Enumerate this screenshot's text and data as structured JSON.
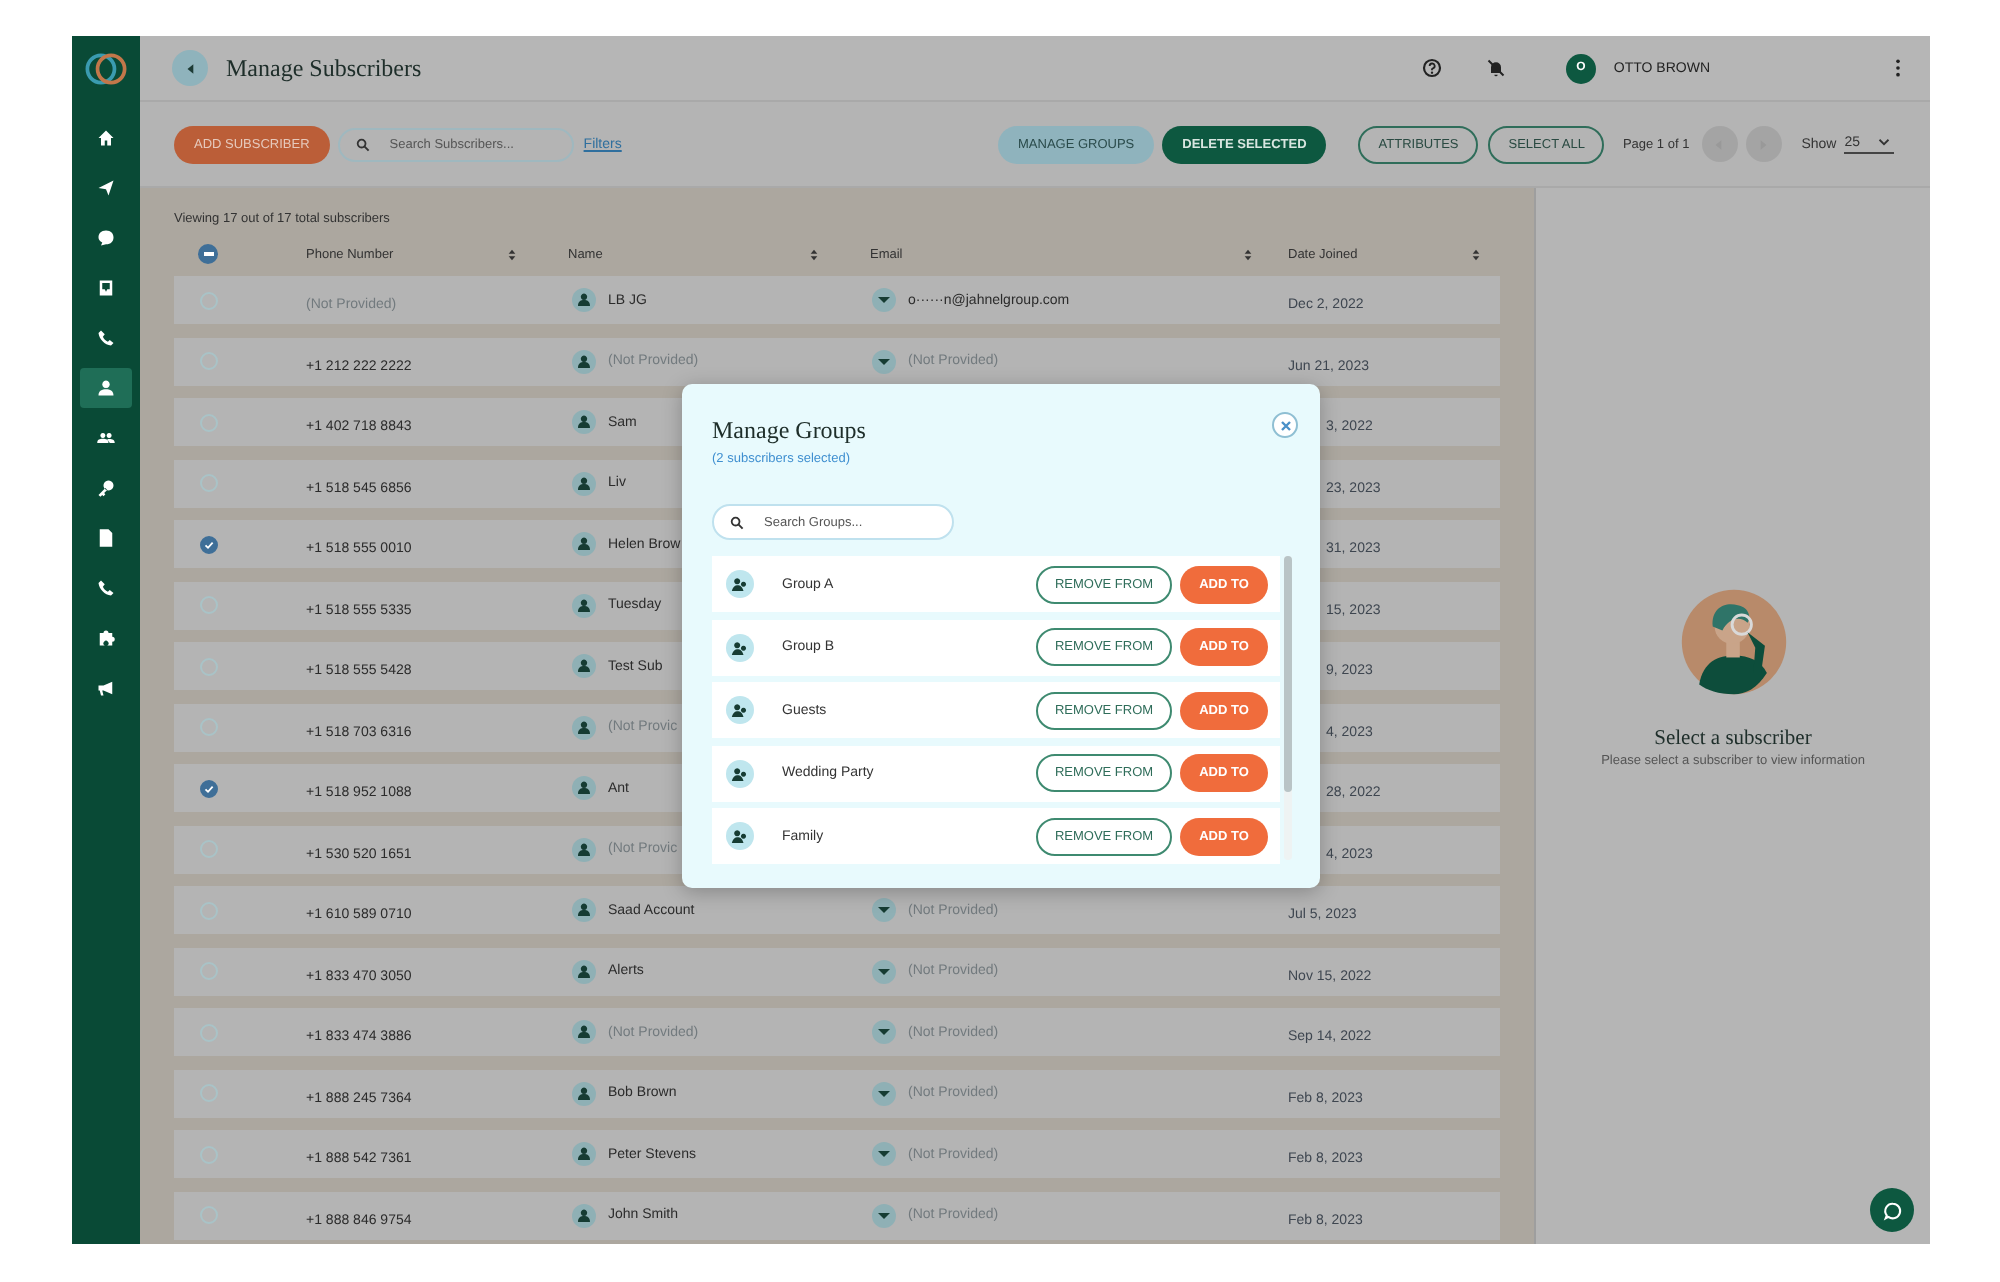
{
  "sidebar": {
    "items": [
      {
        "selected": false
      },
      {
        "selected": false
      },
      {
        "selected": false
      },
      {
        "selected": false
      },
      {
        "selected": false
      },
      {
        "selected": true
      },
      {
        "selected": false
      },
      {
        "selected": false
      },
      {
        "selected": false
      },
      {
        "selected": false
      },
      {
        "selected": false
      },
      {
        "selected": false
      }
    ]
  },
  "header": {
    "title": "Manage Subscribers",
    "user_initial": "O",
    "user_name": "OTTO BROWN"
  },
  "toolbar": {
    "add_button": "ADD SUBSCRIBER",
    "search_placeholder": "Search Subscribers...",
    "filters_link": "Filters",
    "manage_groups": "MANAGE GROUPS",
    "delete_selected": "DELETE SELECTED",
    "attributes": "ATTRIBUTES",
    "select_all": "SELECT ALL",
    "page_info": "Page 1 of 1",
    "show_label": "Show",
    "show_value": "25"
  },
  "table": {
    "summary": "Viewing 17 out of 17 total subscribers",
    "select_all_partial": true,
    "columns": [
      "Phone Number",
      "Name",
      "Email",
      "Date Joined"
    ],
    "rows": [
      {
        "checked": false,
        "phone": "(Not Provided)",
        "phone_missing": true,
        "name": "LB JG",
        "name_missing": false,
        "email": "o······n@jahnelgroup.com",
        "email_missing": false,
        "date": "Dec 2, 2022"
      },
      {
        "checked": false,
        "phone": "+1 212 222 2222",
        "phone_missing": false,
        "name": "(Not Provided)",
        "name_missing": true,
        "email": "(Not Provided)",
        "email_missing": true,
        "date": "Jun 21, 2023"
      },
      {
        "checked": false,
        "phone": "+1 402 718 8843",
        "phone_missing": false,
        "name": "Sam",
        "name_missing": false,
        "date": "3, 2022"
      },
      {
        "checked": false,
        "phone": "+1 518 545 6856",
        "phone_missing": false,
        "name": "Liv",
        "name_missing": false,
        "date": "23, 2023"
      },
      {
        "checked": true,
        "phone": "+1 518 555 0010",
        "phone_missing": false,
        "name": "Helen Brow",
        "name_missing": false,
        "date": "31, 2023"
      },
      {
        "checked": false,
        "phone": "+1 518 555 5335",
        "phone_missing": false,
        "name": "Tuesday",
        "name_missing": false,
        "date": "15, 2023"
      },
      {
        "checked": false,
        "phone": "+1 518 555 5428",
        "phone_missing": false,
        "name": "Test Sub",
        "name_missing": false,
        "date": "9, 2023"
      },
      {
        "checked": false,
        "phone": "+1 518 703 6316",
        "phone_missing": false,
        "name": "(Not Provic",
        "name_missing": true,
        "date": "4, 2023"
      },
      {
        "checked": true,
        "phone": "+1 518 952 1088",
        "phone_missing": false,
        "name": "Ant",
        "name_missing": false,
        "date": "28, 2022"
      },
      {
        "checked": false,
        "phone": "+1 530 520 1651",
        "phone_missing": false,
        "name": "(Not Provic",
        "name_missing": true,
        "date": "4, 2023"
      },
      {
        "checked": false,
        "phone": "+1 610 589 0710",
        "phone_missing": false,
        "name": "Saad Account",
        "name_missing": false,
        "email": "(Not Provided)",
        "email_missing": true,
        "date": "Jul 5, 2023"
      },
      {
        "checked": false,
        "phone": "+1 833 470 3050",
        "phone_missing": false,
        "name": "Alerts",
        "name_missing": false,
        "email": "(Not Provided)",
        "email_missing": true,
        "date": "Nov 15, 2022"
      },
      {
        "checked": false,
        "phone": "+1 833 474 3886",
        "phone_missing": false,
        "name": "(Not Provided)",
        "name_missing": true,
        "email": "(Not Provided)",
        "email_missing": true,
        "date": "Sep 14, 2022"
      },
      {
        "checked": false,
        "phone": "+1 888 245 7364",
        "phone_missing": false,
        "name": "Bob Brown",
        "name_missing": false,
        "email": "(Not Provided)",
        "email_missing": true,
        "date": "Feb 8, 2023"
      },
      {
        "checked": false,
        "phone": "+1 888 542 7361",
        "phone_missing": false,
        "name": "Peter Stevens",
        "name_missing": false,
        "email": "(Not Provided)",
        "email_missing": true,
        "date": "Feb 8, 2023"
      },
      {
        "checked": false,
        "phone": "+1 888 846 9754",
        "phone_missing": false,
        "name": "John Smith",
        "name_missing": false,
        "email": "(Not Provided)",
        "email_missing": true,
        "date": "Feb 8, 2023"
      }
    ]
  },
  "empty_panel": {
    "title": "Select a subscriber",
    "message": "Please select a subscriber to view information"
  },
  "modal": {
    "title": "Manage Groups",
    "subtitle": "(2 subscribers selected)",
    "search_placeholder": "Search Groups...",
    "groups": [
      {
        "name": "Group A",
        "remove_label": "REMOVE FROM",
        "add_label": "ADD TO"
      },
      {
        "name": "Group B",
        "remove_label": "REMOVE FROM",
        "add_label": "ADD TO"
      },
      {
        "name": "Guests",
        "remove_label": "REMOVE FROM",
        "add_label": "ADD TO"
      },
      {
        "name": "Wedding Party",
        "remove_label": "REMOVE FROM",
        "add_label": "ADD TO"
      },
      {
        "name": "Family",
        "remove_label": "REMOVE FROM",
        "add_label": "ADD TO"
      }
    ]
  }
}
